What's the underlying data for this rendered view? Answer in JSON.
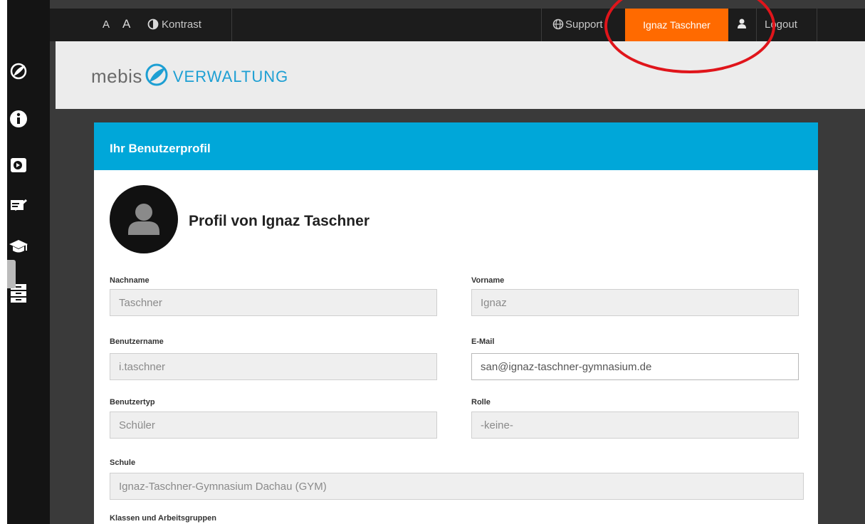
{
  "topbar": {
    "font_smaller": "A",
    "font_larger": "A",
    "contrast_label": "Kontrast",
    "support_label": "Support",
    "user_name": "Ignaz Taschner",
    "logout_label": "Logout"
  },
  "logo": {
    "brand": "mebis",
    "section": "VERWALTUNG"
  },
  "sidebar": {
    "icons": [
      "mebis-leaf-icon",
      "info-icon",
      "media-icon",
      "notebook-icon",
      "graduation-cap-icon",
      "archive-icon"
    ]
  },
  "card": {
    "title": "Ihr Benutzerprofil",
    "profile_heading": "Profil von Ignaz Taschner"
  },
  "fields": {
    "nachname": {
      "label": "Nachname",
      "value": "Taschner"
    },
    "vorname": {
      "label": "Vorname",
      "value": "Ignaz"
    },
    "benutzername": {
      "label": "Benutzername",
      "value": "i.taschner"
    },
    "email": {
      "label": "E-Mail",
      "value": "san@ignaz-taschner-gymnasium.de"
    },
    "benutzertyp": {
      "label": "Benutzertyp",
      "value": "Schüler"
    },
    "rolle": {
      "label": "Rolle",
      "value": "-keine-"
    },
    "schule": {
      "label": "Schule",
      "value": "Ignaz-Taschner-Gymnasium Dachau (GYM)"
    },
    "klassen": {
      "label": "Klassen und Arbeitsgruppen"
    }
  },
  "colors": {
    "accent": "#00a7d9",
    "user_button": "#ff6a00",
    "annotation": "#e0151b"
  }
}
